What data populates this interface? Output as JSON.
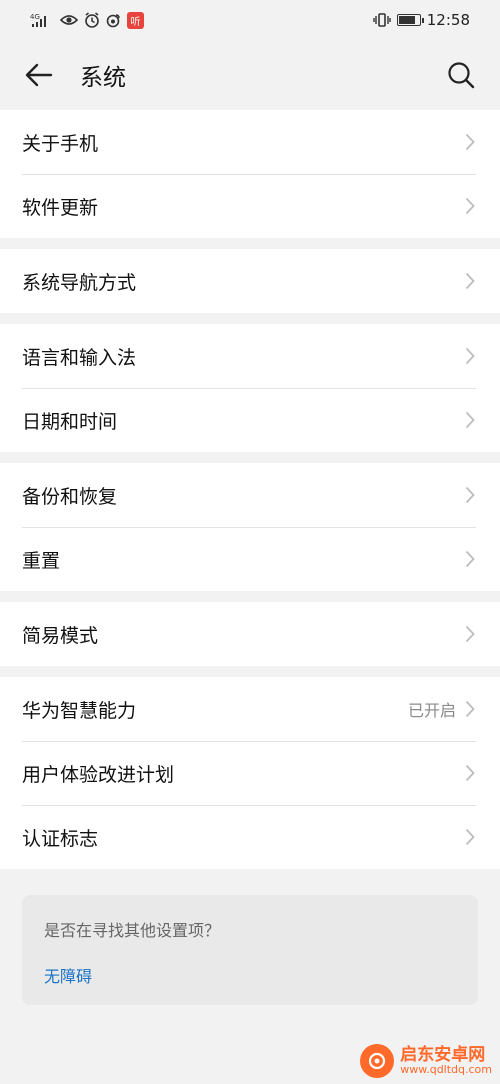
{
  "status_bar": {
    "network": "4G",
    "app_badge": "听",
    "time": "12:58",
    "battery_level": 0.85
  },
  "header": {
    "title": "系统"
  },
  "groups": [
    {
      "items": [
        {
          "label": "关于手机"
        },
        {
          "label": "软件更新"
        }
      ]
    },
    {
      "items": [
        {
          "label": "系统导航方式"
        }
      ]
    },
    {
      "items": [
        {
          "label": "语言和输入法"
        },
        {
          "label": "日期和时间"
        }
      ]
    },
    {
      "items": [
        {
          "label": "备份和恢复"
        },
        {
          "label": "重置"
        }
      ]
    },
    {
      "items": [
        {
          "label": "简易模式"
        }
      ]
    },
    {
      "items": [
        {
          "label": "华为智慧能力",
          "value": "已开启"
        },
        {
          "label": "用户体验改进计划"
        },
        {
          "label": "认证标志"
        }
      ]
    }
  ],
  "suggestion": {
    "question": "是否在寻找其他设置项？",
    "link": "无障碍"
  },
  "watermark": {
    "name": "启东安卓网",
    "url": "www.qdltdq.com"
  },
  "colors": {
    "accent_link": "#1a73c8",
    "background": "#f2f2f2",
    "watermark": "#ff6a2b"
  }
}
